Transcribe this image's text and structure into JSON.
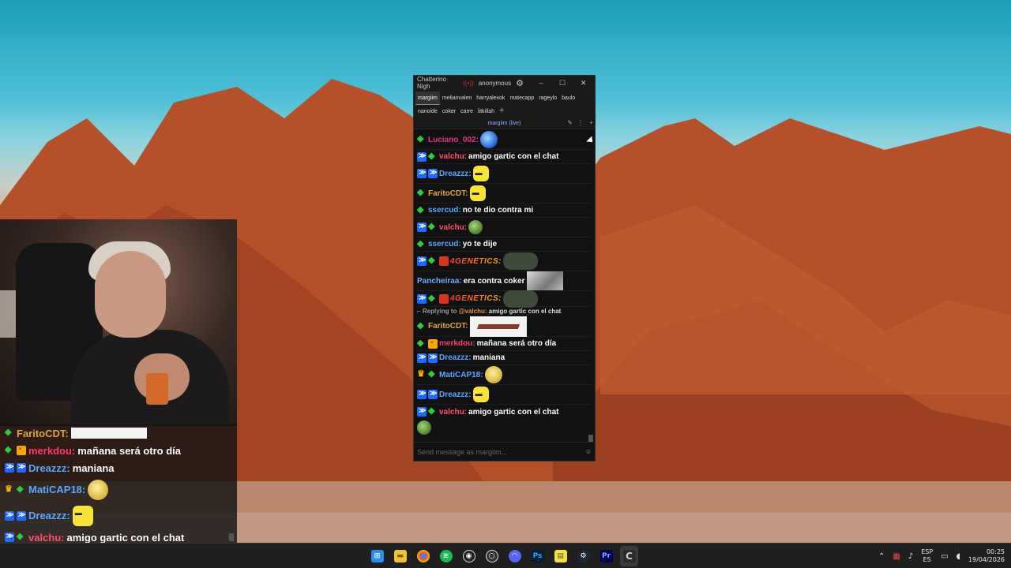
{
  "chatterino": {
    "window_title": "Chatterino Nigh",
    "account": "anonymous",
    "tabs": [
      "margiim",
      "melianvalen",
      "harryalexok",
      "matecapp",
      "rageylo",
      "baulo",
      "nanoide",
      "coker",
      "carre",
      "litkillah"
    ],
    "add_tab": "+",
    "split_header": "margiim (live)",
    "input_placeholder": "Send message as margiim...",
    "messages": [
      {
        "name": "Luciano_002:",
        "text": "",
        "color": "#e0338d"
      },
      {
        "name": "valchu:",
        "text": "amigo gartic con el chat",
        "color": "#ff4f6e"
      },
      {
        "name": "Dreazzz:",
        "text": "",
        "color": "#5aa7ff"
      },
      {
        "name": "FaritoCDT:",
        "text": "",
        "color": "#e0a43a"
      },
      {
        "name": "ssercud:",
        "text": "no te dio contra mi",
        "color": "#5aa7ff"
      },
      {
        "name": "valchu:",
        "text": "",
        "color": "#ff4f6e"
      },
      {
        "name": "ssercud:",
        "text": "yo te dije",
        "color": "#5aa7ff"
      },
      {
        "name": "4GENETICS:",
        "text": "",
        "color": "#ff5a2a"
      },
      {
        "name": "Pancheiraa:",
        "text": "era contra coker",
        "color": "#6fa8ff"
      },
      {
        "name": "4GENETICS:",
        "text": "",
        "color": "#ff5a2a"
      },
      {
        "name": "FaritoCDT:",
        "text": "",
        "color": "#e0a43a"
      },
      {
        "name": "merkdou:",
        "text": "mañana será otro día",
        "color": "#ff3b6a"
      },
      {
        "name": "Dreazzz:",
        "text": "maniana",
        "color": "#5aa7ff"
      },
      {
        "name": "MatiCAP18:",
        "text": "",
        "color": "#5aa7ff"
      },
      {
        "name": "Dreazzz:",
        "text": "",
        "color": "#5aa7ff"
      },
      {
        "name": "valchu:",
        "text": "amigo gartic con el chat",
        "color": "#ff4f6e"
      }
    ],
    "reply": {
      "prefix": "Replying to",
      "to": "@valchu:",
      "text": "amigo gartic con el chat"
    }
  },
  "overlay_chat": [
    {
      "name": "FaritoCDT:",
      "text": "",
      "color": "#e0a43a"
    },
    {
      "name": "merkdou:",
      "text": "mañana será otro día",
      "color": "#ff3b6a"
    },
    {
      "name": "Dreazzz:",
      "text": "maniana",
      "color": "#5aa7ff"
    },
    {
      "name": "MatiCAP18:",
      "text": "",
      "color": "#5aa7ff"
    },
    {
      "name": "Dreazzz:",
      "text": "",
      "color": "#5aa7ff"
    },
    {
      "name": "valchu:",
      "text": "amigo gartic con el chat",
      "color": "#ff4f6e"
    }
  ],
  "taskbar": {
    "icons": [
      "windows-icon",
      "file-explorer-icon",
      "chrome-icon",
      "spotify-icon",
      "obs-icon",
      "recording-icon",
      "discord-icon",
      "photoshop-icon",
      "sticky-notes-icon",
      "steam-icon",
      "premiere-icon",
      "chatterino-icon"
    ],
    "lang_top": "ESP",
    "lang_bottom": "ES",
    "time": "00:25",
    "date": "19/04/2026"
  }
}
